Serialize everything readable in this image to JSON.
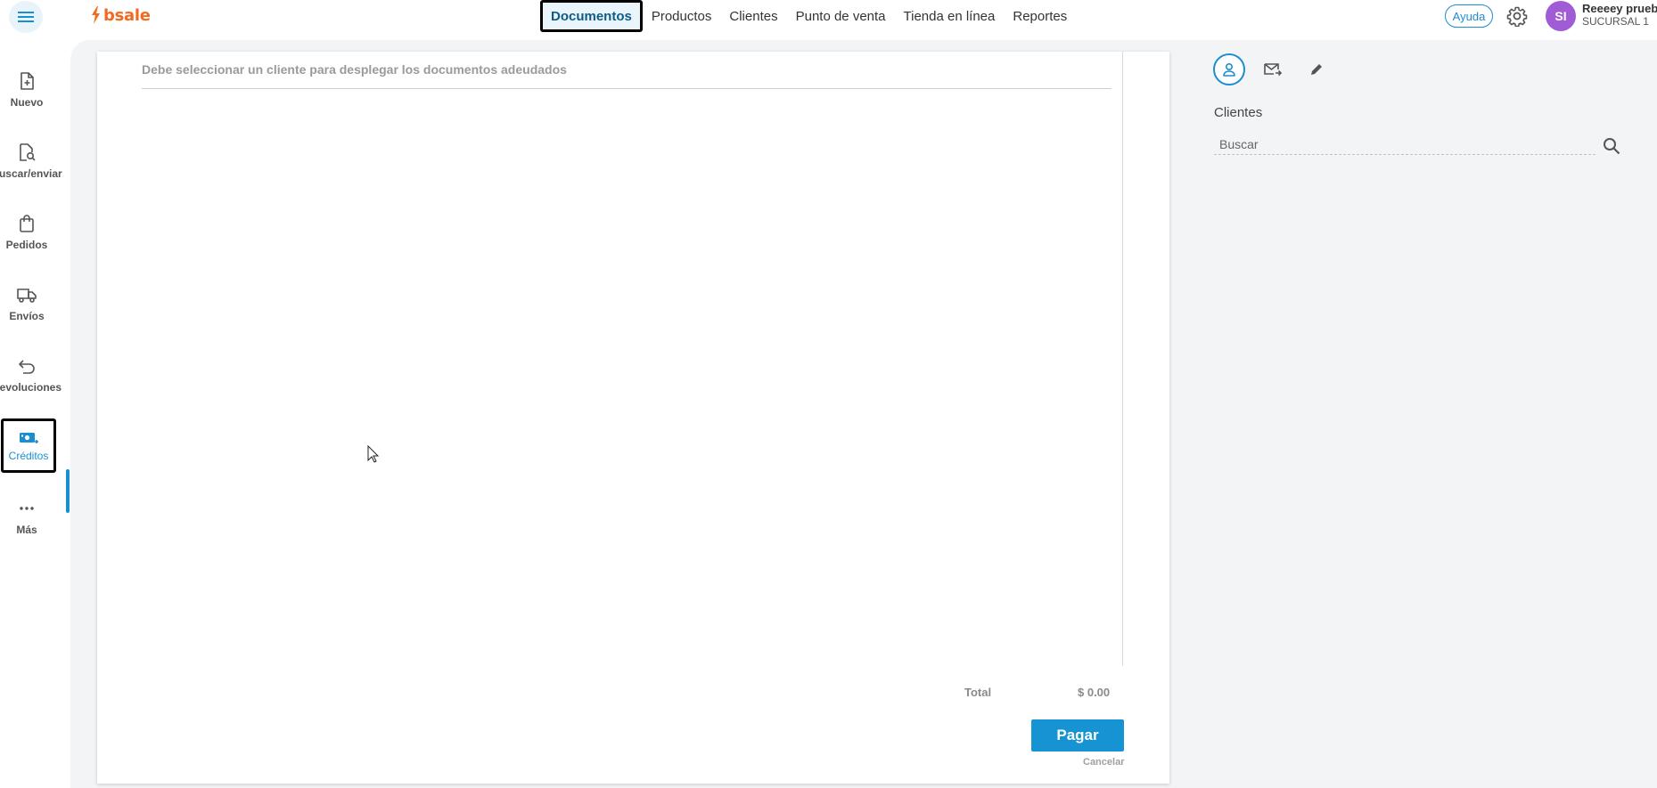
{
  "brand": {
    "name": "bsale",
    "color": "#f26a21"
  },
  "topnav": [
    {
      "label": "Documentos",
      "active": true
    },
    {
      "label": "Productos"
    },
    {
      "label": "Clientes"
    },
    {
      "label": "Punto de venta"
    },
    {
      "label": "Tienda en línea"
    },
    {
      "label": "Reportes"
    }
  ],
  "header": {
    "help_label": "Ayuda",
    "avatar_initials": "SI",
    "user_name": "Reeeey prueb.",
    "branch": "SUCURSAL 1"
  },
  "sidebar": {
    "items": [
      {
        "label": "Nuevo",
        "icon": "new-document-icon"
      },
      {
        "label": "Buscar/enviar",
        "icon": "search-document-icon"
      },
      {
        "label": "Pedidos",
        "icon": "shopping-bag-icon"
      },
      {
        "label": "Envíos",
        "icon": "truck-icon"
      },
      {
        "label": "Devoluciones",
        "icon": "return-arrow-icon"
      },
      {
        "label": "Créditos",
        "icon": "credit-money-icon",
        "active": true
      },
      {
        "label": "Más",
        "icon": "more-dots-icon"
      }
    ]
  },
  "main": {
    "message": "Debe seleccionar un cliente para desplegar los documentos adeudados",
    "total_label": "Total",
    "total_value": "$ 0.00",
    "pay_label": "Pagar",
    "cancel_label": "Cancelar"
  },
  "right_panel": {
    "tabs": [
      {
        "icon": "person-icon",
        "active": true
      },
      {
        "icon": "mail-forward-icon"
      },
      {
        "icon": "pencil-icon"
      }
    ],
    "title": "Clientes",
    "search_placeholder": "Buscar"
  },
  "colors": {
    "accent": "#1a8fd0",
    "pay_button": "#1593d2",
    "avatar": "#a05cd6",
    "background": "#f3f4f6"
  }
}
